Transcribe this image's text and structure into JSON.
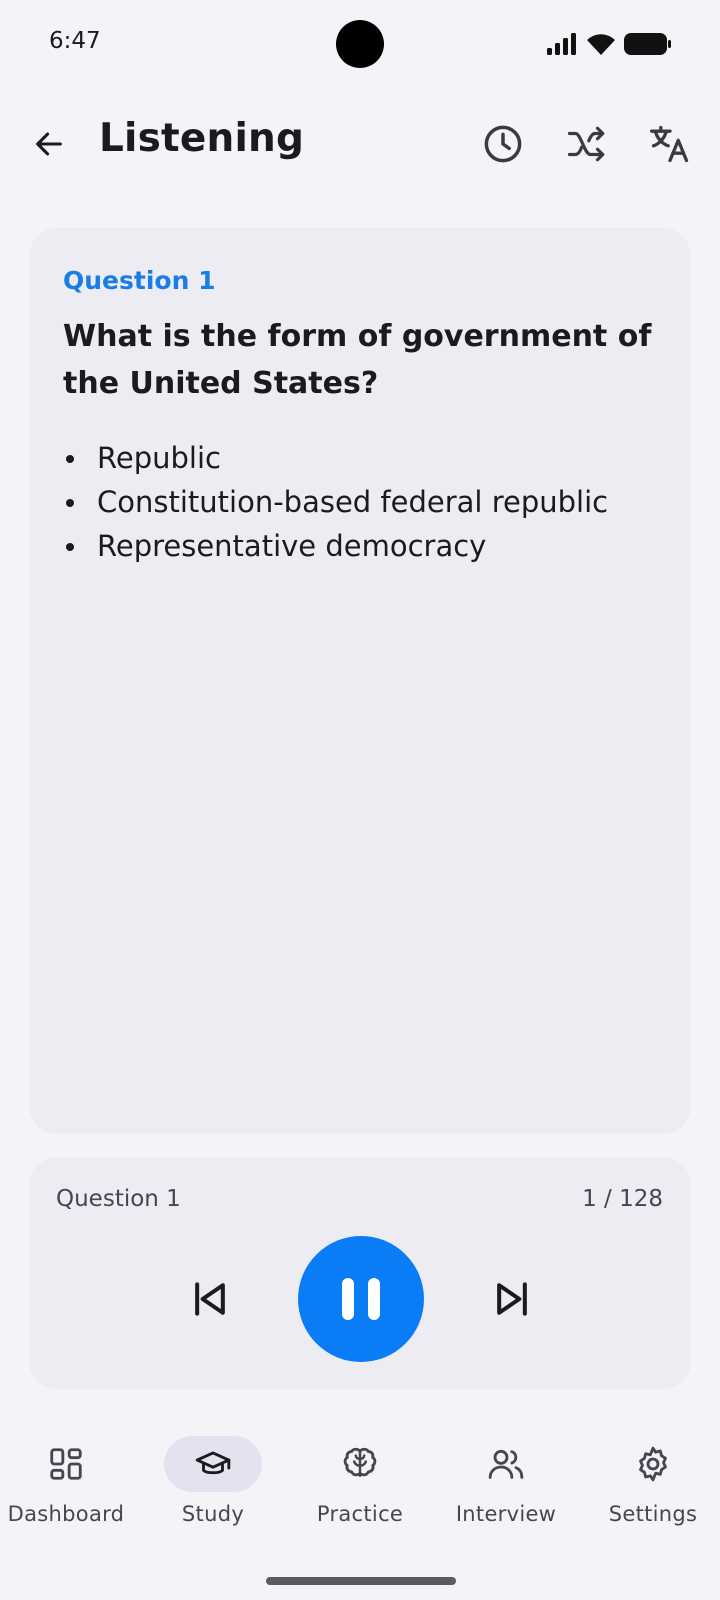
{
  "status_bar": {
    "time": "6:47"
  },
  "header": {
    "title": "Listening",
    "back_icon": "arrow-back-icon",
    "actions": [
      "history-icon",
      "shuffle-icon",
      "translate-icon"
    ]
  },
  "card": {
    "question_label": "Question 1",
    "question_text": "What is the form of government of the United States?",
    "answers": [
      "Republic",
      "Constitution-based federal republic",
      "Representative democracy"
    ]
  },
  "player": {
    "label": "Question 1",
    "count": "1 / 128",
    "state": "playing",
    "accent": "#0a7cf5"
  },
  "nav": {
    "items": [
      {
        "label": "Dashboard",
        "icon": "dashboard-icon"
      },
      {
        "label": "Study",
        "icon": "graduation-cap-icon",
        "active": true
      },
      {
        "label": "Practice",
        "icon": "brain-icon"
      },
      {
        "label": "Interview",
        "icon": "people-icon"
      },
      {
        "label": "Settings",
        "icon": "gear-icon"
      }
    ]
  },
  "colors": {
    "background": "#f4f4f8",
    "card": "#ececf2",
    "accent_text": "#1a7de6",
    "active_nav_pill": "#e3e2ef"
  }
}
